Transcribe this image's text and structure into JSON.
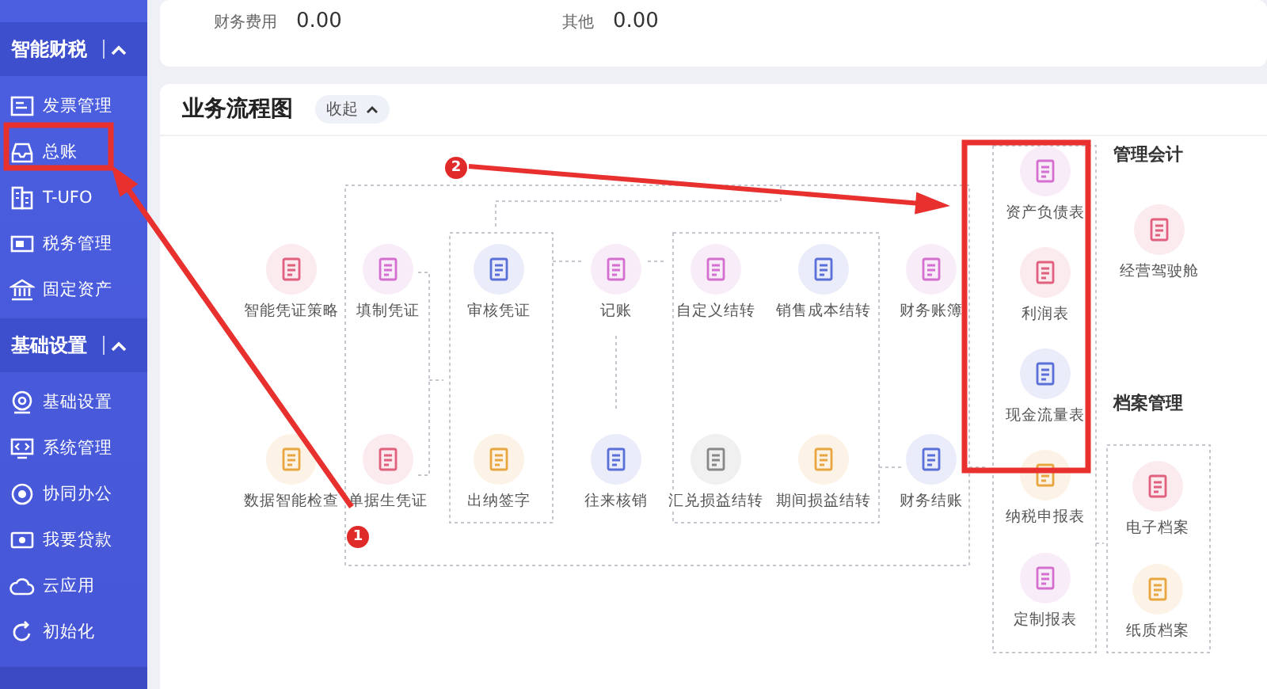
{
  "sidebar": {
    "sections": [
      {
        "title": "智能财税",
        "expanded": true,
        "items": [
          {
            "label": "发票管理"
          },
          {
            "label": "总账"
          },
          {
            "label": "T-UFO"
          },
          {
            "label": "税务管理"
          },
          {
            "label": "固定资产"
          }
        ]
      },
      {
        "title": "基础设置",
        "expanded": true,
        "items": [
          {
            "label": "基础设置"
          },
          {
            "label": "系统管理"
          },
          {
            "label": "协同办公"
          },
          {
            "label": "我要贷款"
          },
          {
            "label": "云应用"
          },
          {
            "label": "初始化"
          }
        ]
      }
    ]
  },
  "summary": [
    {
      "label": "财务费用",
      "value": "0.00"
    },
    {
      "label": "其他",
      "value": "0.00"
    }
  ],
  "flow": {
    "title": "业务流程图",
    "toggle": {
      "label": "收起",
      "expanded": true
    },
    "nodes": [
      {
        "label": "智能凭证策略",
        "color": "#e0607e"
      },
      {
        "label": "填制凭证",
        "color": "#d46fd0"
      },
      {
        "label": "审核凭证",
        "color": "#5a6fd8"
      },
      {
        "label": "记账",
        "color": "#d46fd0"
      },
      {
        "label": "自定义结转",
        "color": "#d46fd0"
      },
      {
        "label": "销售成本结转",
        "color": "#5a6fd8"
      },
      {
        "label": "财务账簿",
        "color": "#d46fd0"
      },
      {
        "label": "数据智能检查",
        "color": "#e8a640"
      },
      {
        "label": "单据生凭证",
        "color": "#e0607e"
      },
      {
        "label": "出纳签字",
        "color": "#e8a640"
      },
      {
        "label": "往来核销",
        "color": "#5a6fd8"
      },
      {
        "label": "汇兑损益结转",
        "color": "#888888"
      },
      {
        "label": "期间损益结转",
        "color": "#e8a640"
      },
      {
        "label": "财务结账",
        "color": "#5a6fd8"
      },
      {
        "label": "资产负债表",
        "color": "#d46fd0"
      },
      {
        "label": "利润表",
        "color": "#e0607e"
      },
      {
        "label": "现金流量表",
        "color": "#5a6fd8"
      },
      {
        "label": "纳税申报表",
        "color": "#e8a640"
      },
      {
        "label": "定制报表",
        "color": "#d46fd0"
      }
    ],
    "sections": [
      {
        "title": "管理会计",
        "nodes": [
          {
            "label": "经营驾驶舱",
            "color": "#e0607e"
          }
        ]
      },
      {
        "title": "档案管理",
        "nodes": [
          {
            "label": "电子档案",
            "color": "#e0607e"
          },
          {
            "label": "纸质档案",
            "color": "#e8a640"
          }
        ]
      }
    ]
  },
  "annotations": {
    "markers": [
      {
        "number": "1"
      },
      {
        "number": "2"
      }
    ]
  }
}
